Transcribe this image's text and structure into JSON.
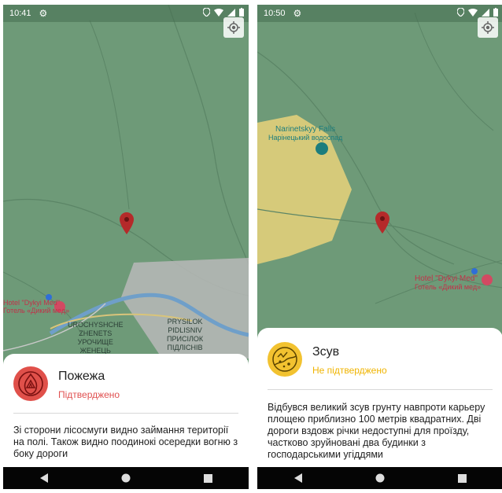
{
  "screens": [
    {
      "status_bar": {
        "time": "10:41"
      },
      "map": {
        "labels": {
          "hotel_en": "Hotel \"Dykyi Med\"",
          "hotel_ua": "Готель «Дикий мед»",
          "urochyshche": "UROCHYSHCHE\nZHENETS\nУРОЧИЩЕ\nЖЕНЕЦЬ",
          "prysilok": "PRYSILOK\nPIDLISNIV\nПРИСІЛОК\nПІДЛІСНІВ"
        }
      },
      "report": {
        "title": "Пожежа",
        "status": "Підтверджено",
        "description": "Зі сторони лісосмуги видно займання території на полі. Також видно поодинокі осередки вогню з боку дороги"
      }
    },
    {
      "status_bar": {
        "time": "10:50"
      },
      "map": {
        "labels": {
          "falls_en": "Narinetskyy Falls",
          "falls_ua": "Нарінецький водоспад",
          "hotel_en": "Hotel \"Dykyi Med\"",
          "hotel_ua": "Готель «Дикий мед»"
        }
      },
      "report": {
        "title": "Зсув",
        "status": "Не підтверджено",
        "description": "Відбувся великий зсув грунту навпроти карьеру площею приблизно 100 метрів квадратних. Дві дороги вздовж річки недоступні для проїзду, частково зруйновані два будинки з господарськими угіддями"
      }
    }
  ],
  "icons": [
    "gear-icon",
    "location-icon",
    "wifi-icon",
    "signal-icon",
    "battery-icon",
    "my-location-icon",
    "map-pin-icon",
    "fire-icon",
    "landslide-icon",
    "back-icon",
    "home-icon",
    "recents-icon"
  ],
  "colors": {
    "map_green": "#6e9a78",
    "pin_red": "#b52a2a",
    "confirmed_red": "#e05050",
    "pending_yellow": "#f0b400",
    "fire_avatar": "#e0504a",
    "slide_avatar": "#f2c230"
  }
}
